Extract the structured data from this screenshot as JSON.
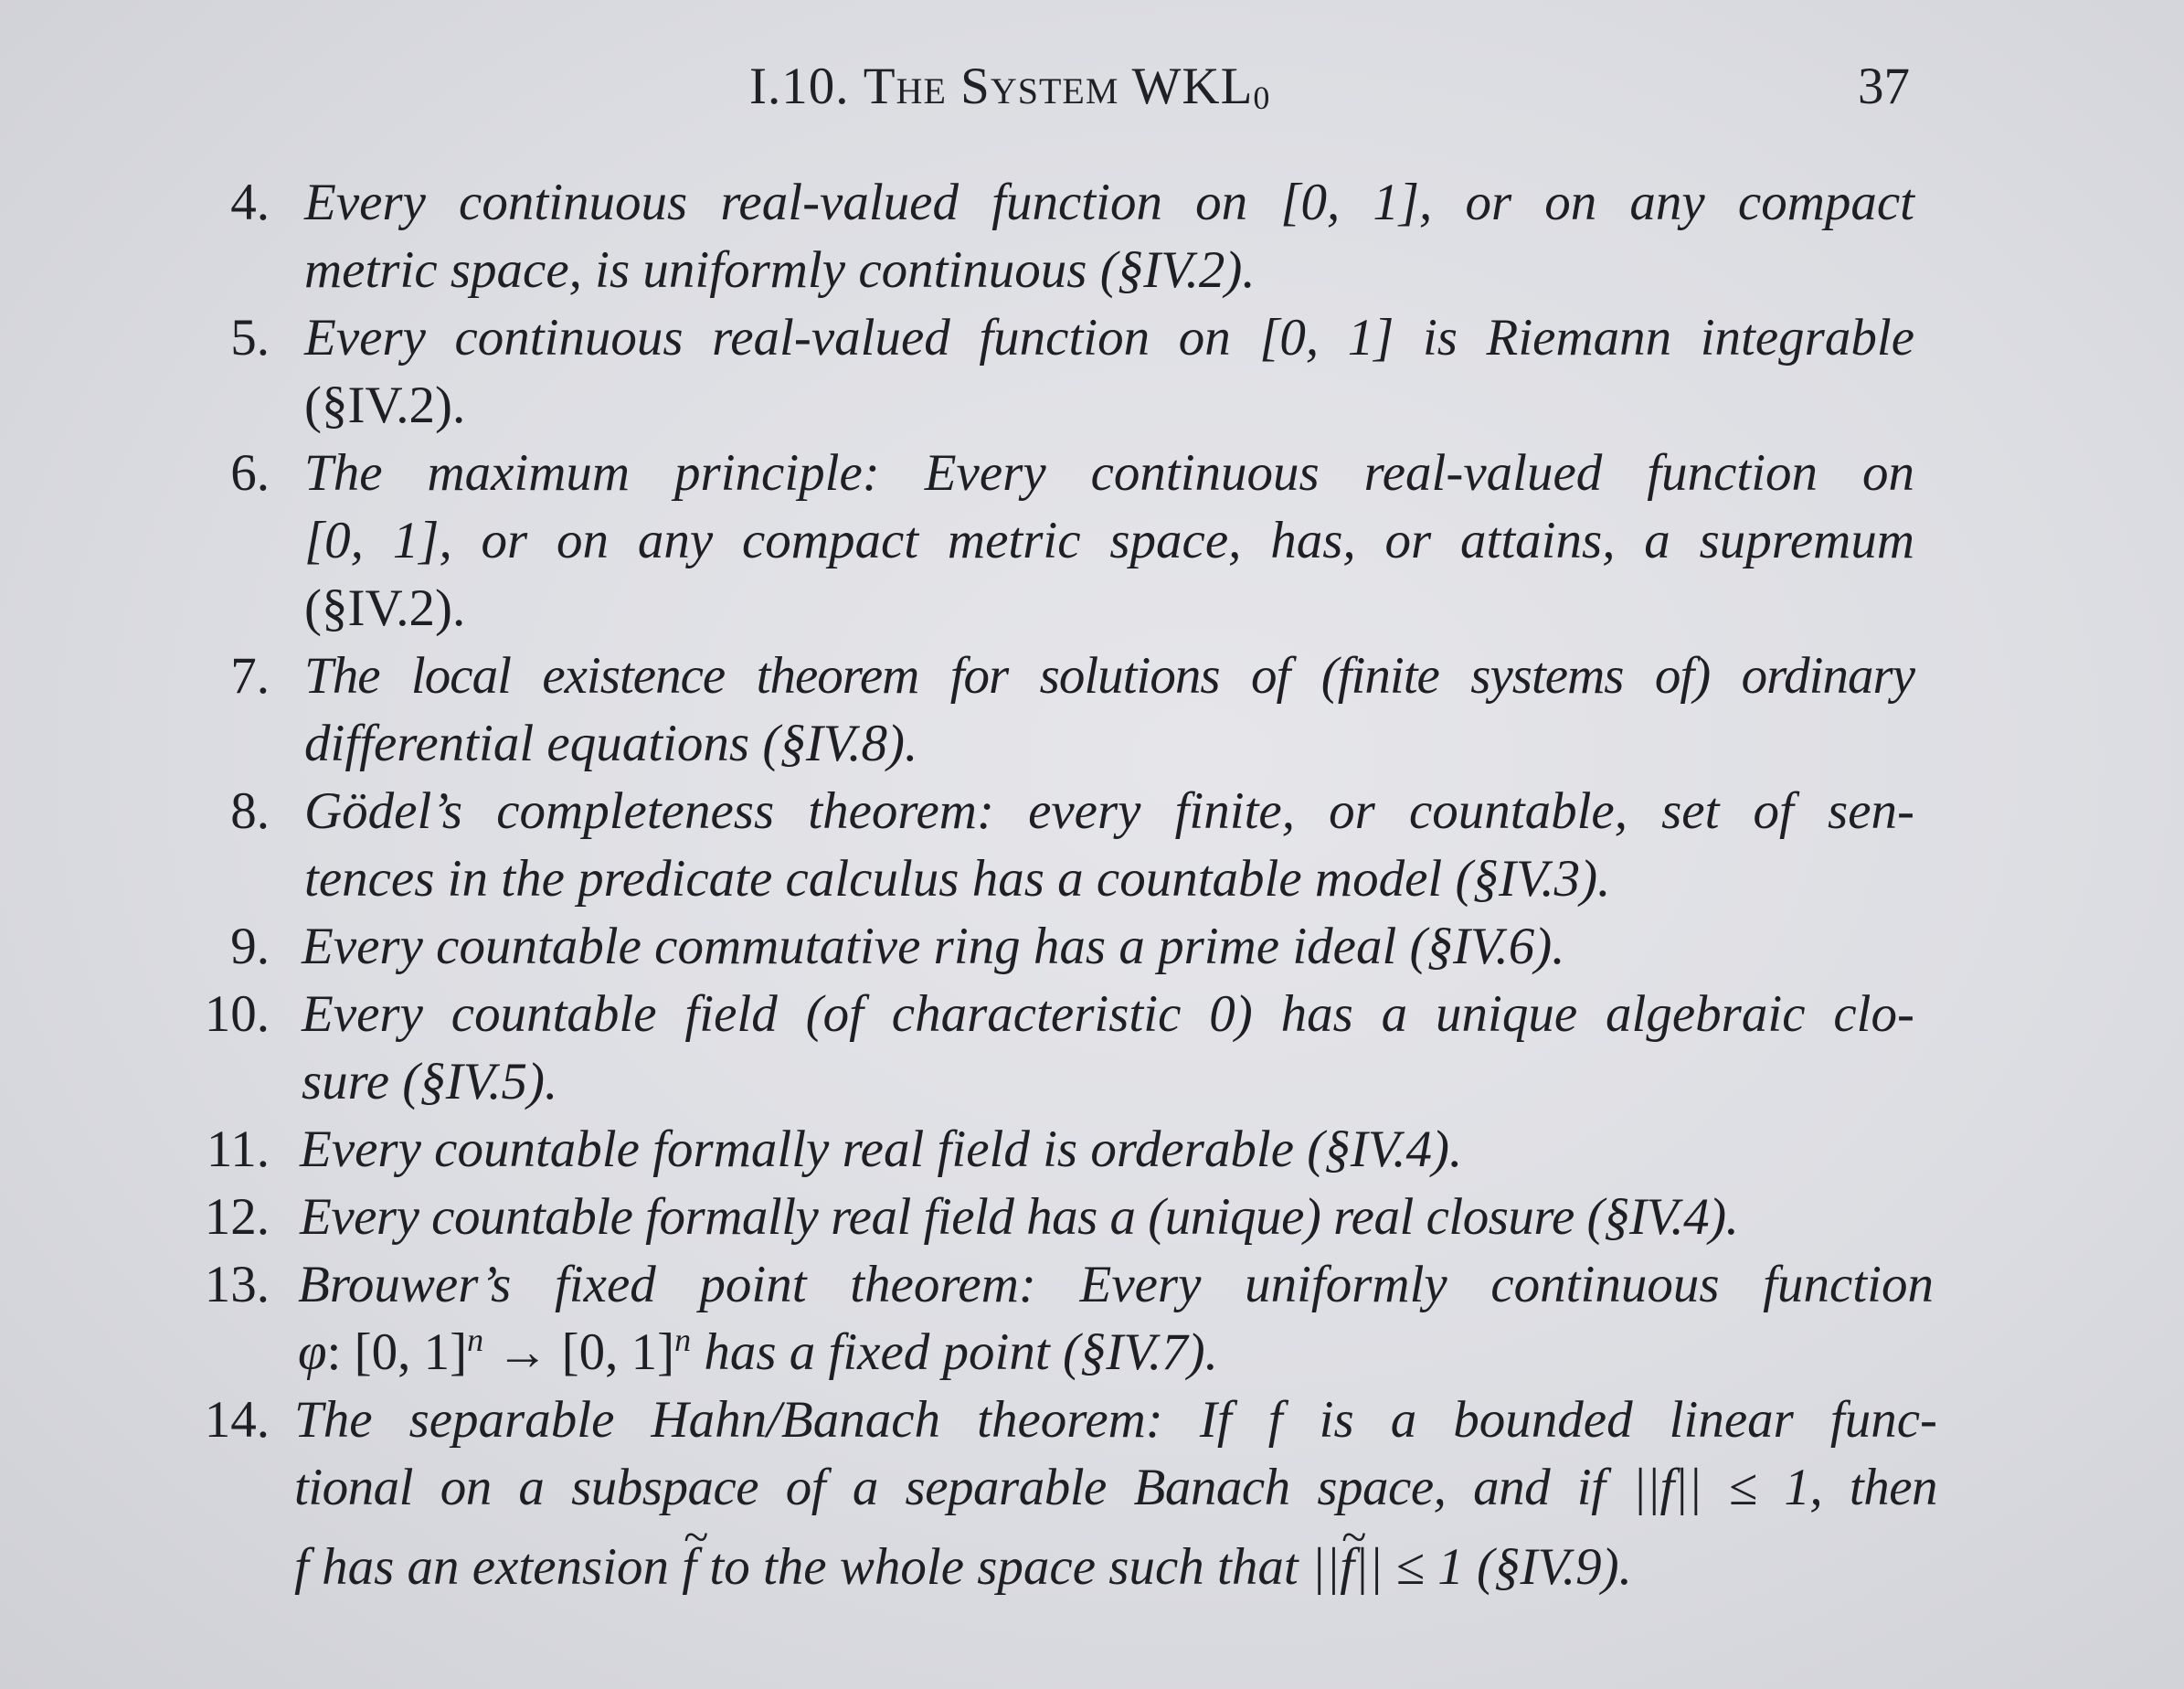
{
  "header": {
    "section": "I.10.",
    "title_small_caps": "The System",
    "system_base": "WKL",
    "system_sub": "0",
    "page_number": "37"
  },
  "items": [
    {
      "number": "4.",
      "lines": [
        "Every continuous real-valued function on [0, 1], or on any compact",
        "metric space, is uniformly continuous (§IV.2)."
      ]
    },
    {
      "number": "5.",
      "lines": [
        "Every continuous real-valued function on [0, 1] is Riemann integrable",
        "(§IV.2)."
      ]
    },
    {
      "number": "6.",
      "lines": [
        "The maximum principle: Every continuous real-valued function on",
        "[0, 1], or on any compact metric space, has, or attains, a supremum",
        "(§IV.2)."
      ]
    },
    {
      "number": "7.",
      "lines": [
        "The local existence theorem for solutions of (finite systems of) ordinary",
        "differential equations (§IV.8)."
      ]
    },
    {
      "number": "8.",
      "lines": [
        "Gödel’s completeness theorem: every finite, or countable, set of sen-",
        "tences in the predicate calculus has a countable model (§IV.3)."
      ]
    },
    {
      "number": "9.",
      "lines": [
        "Every countable commutative ring has a prime ideal (§IV.6)."
      ]
    },
    {
      "number": "10.",
      "lines": [
        "Every countable field (of characteristic 0) has a unique algebraic clo-",
        "sure (§IV.5)."
      ]
    },
    {
      "number": "11.",
      "lines": [
        "Every countable formally real field is orderable (§IV.4)."
      ]
    },
    {
      "number": "12.",
      "lines": [
        "Every countable formally real field has a (unique) real closure (§IV.4)."
      ]
    },
    {
      "number": "13.",
      "lines": [
        "Brouwer’s fixed point theorem: Every uniformly continuous function"
      ],
      "formula": {
        "phi": "φ",
        "colon": ":",
        "domain": "[0, 1]",
        "exp1": "n",
        "arrow": "→",
        "codomain": "[0, 1]",
        "exp2": "n",
        "rest": "has a fixed point (§IV.7)."
      }
    },
    {
      "number": "14.",
      "lines": [
        "The separable Hahn/Banach theorem: If f is a bounded linear func-",
        "tional on a subspace of a separable Banach space, and if ||f|| ≤ 1, then"
      ],
      "last_line": {
        "f": "f",
        "middle": "has an extension",
        "f_tilde": "f",
        "tilde": "~",
        "after": "to the whole space such that ||",
        "f_tilde2": "f",
        "end": "|| ≤ 1 (§IV.9)."
      }
    }
  ]
}
